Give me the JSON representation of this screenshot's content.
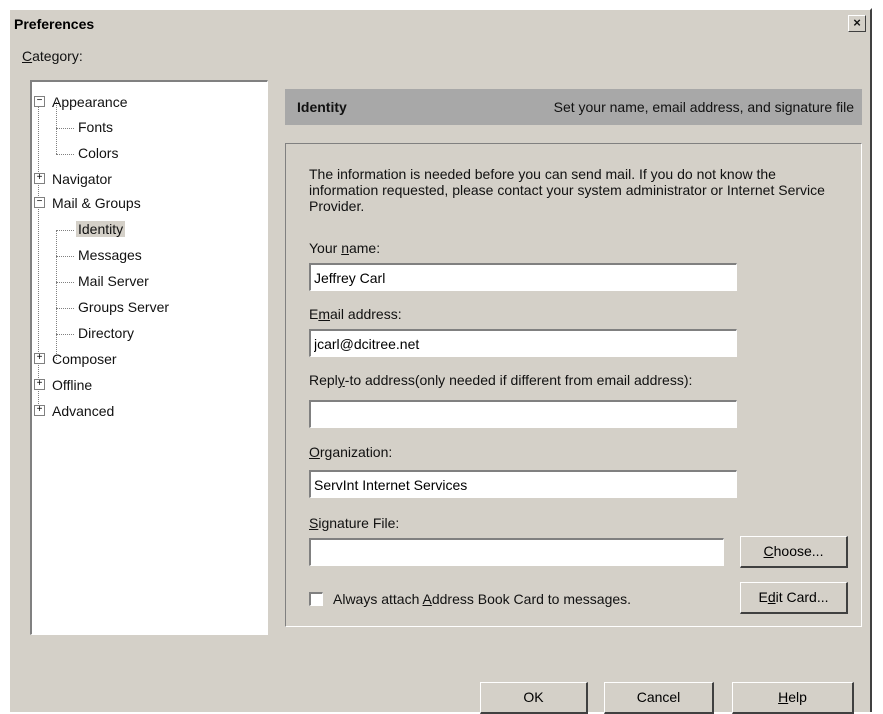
{
  "window": {
    "title": "Preferences",
    "close_glyph": "×"
  },
  "category": {
    "label_underlined": "C",
    "label_rest": "ategory:"
  },
  "tree": [
    {
      "label": "Appearance",
      "expander": "−"
    },
    {
      "label": "Fonts"
    },
    {
      "label": "Colors"
    },
    {
      "label": "Navigator",
      "expander": "+"
    },
    {
      "label": "Mail & Groups",
      "expander": "−"
    },
    {
      "label": "Identity",
      "selected": true
    },
    {
      "label": "Messages"
    },
    {
      "label": "Mail Server"
    },
    {
      "label": "Groups Server"
    },
    {
      "label": "Directory"
    },
    {
      "label": "Composer",
      "expander": "+"
    },
    {
      "label": "Offline",
      "expander": "+"
    },
    {
      "label": "Advanced",
      "expander": "+"
    }
  ],
  "header": {
    "title": "Identity",
    "description": "Set your name, email address, and signature file"
  },
  "identity": {
    "info": "The information is needed before you can send mail.  If you do not know the information requested, please contact your system administrator or Internet Service Provider.",
    "name_label_pre": "Your ",
    "name_label_ul": "n",
    "name_label_post": "ame:",
    "name_value": "Jeffrey Carl",
    "email_label_pre": "E",
    "email_label_ul": "m",
    "email_label_post": "ail address:",
    "email_value": "jcarl@dcitree.net",
    "reply_label_pre": "Repl",
    "reply_label_ul": "y",
    "reply_label_post": "-to address(only needed if different from email address):",
    "reply_value": "",
    "org_label_ul": "O",
    "org_label_post": "rganization:",
    "org_value": "ServInt Internet Services",
    "sig_label_ul": "S",
    "sig_label_post": "ignature File:",
    "sig_value": "",
    "choose_ul": "C",
    "choose_post": "hoose...",
    "attach_pre": "Always attach ",
    "attach_ul": "A",
    "attach_post": "ddress Book Card to messages.",
    "attach_checked": false,
    "editcard_pre": "E",
    "editcard_ul": "d",
    "editcard_post": "it Card..."
  },
  "footer": {
    "ok": "OK",
    "cancel": "Cancel",
    "help_ul": "H",
    "help_post": "elp"
  }
}
